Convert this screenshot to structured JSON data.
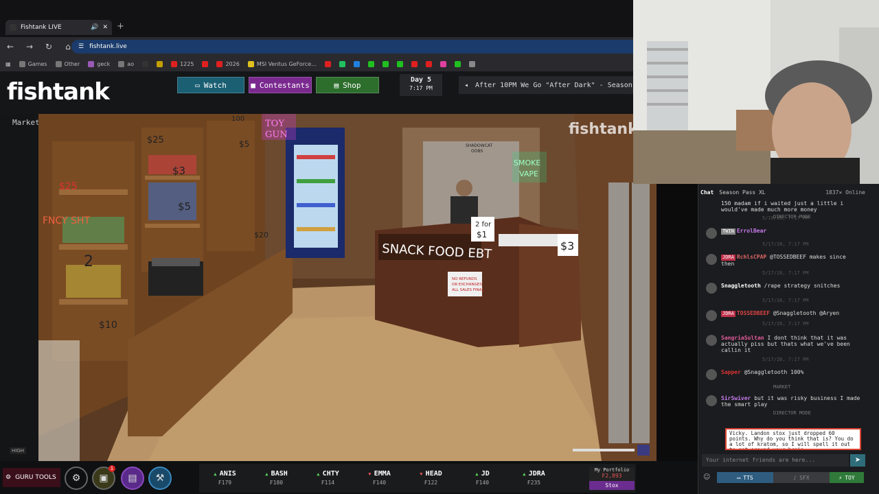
{
  "browser": {
    "tab_title": "Fishtank LIVE",
    "url": "fishtank.live",
    "bookmarks": [
      {
        "label": "Games",
        "color": "#777"
      },
      {
        "label": "Other",
        "color": "#777"
      },
      {
        "label": "geck",
        "color": "#9b59b6"
      },
      {
        "label": "ao",
        "color": "#777"
      },
      {
        "label": "",
        "color": "#333"
      },
      {
        "label": "",
        "color": "#c3a000"
      },
      {
        "label": "1225",
        "color": "#e02020"
      },
      {
        "label": "",
        "color": "#e02020"
      },
      {
        "label": "2026",
        "color": "#e02020"
      },
      {
        "label": "MSI Ventus GeForce...",
        "color": "#e0c020"
      },
      {
        "label": "",
        "color": "#e02020"
      },
      {
        "label": "",
        "color": "#20c060"
      },
      {
        "label": "",
        "color": "#2080e0"
      },
      {
        "label": "",
        "color": "#20c020"
      },
      {
        "label": "",
        "color": "#20c020"
      },
      {
        "label": "",
        "color": "#20c020"
      },
      {
        "label": "",
        "color": "#e02020"
      },
      {
        "label": "",
        "color": "#e02020"
      },
      {
        "label": "",
        "color": "#e040a0"
      },
      {
        "label": "",
        "color": "#20c020"
      },
      {
        "label": "",
        "color": "#888"
      }
    ]
  },
  "site": {
    "logo": "fishtank",
    "nav": {
      "watch": "Watch",
      "contestants": "Contestants",
      "shop": "Shop"
    },
    "day": {
      "label": "Day 5",
      "time": "7:17 PM"
    },
    "ticker": "After 10PM We Go \"After Dark\" - Season",
    "left_label": "Market",
    "quality": "HIGH",
    "watermark": "fishtank"
  },
  "bottom": {
    "guru_label": "GURU TOOLS",
    "guru_badge": "1",
    "stocks": [
      {
        "name": "ANIS",
        "price": "₣179",
        "dir": "up"
      },
      {
        "name": "BASH",
        "price": "₣180",
        "dir": "up"
      },
      {
        "name": "CHTY",
        "price": "₣114",
        "dir": "up"
      },
      {
        "name": "EMMA",
        "price": "₣140",
        "dir": "down"
      },
      {
        "name": "HEAD",
        "price": "₣122",
        "dir": "down"
      },
      {
        "name": "JD",
        "price": "₣140",
        "dir": "up"
      },
      {
        "name": "JDRA",
        "price": "₣235",
        "dir": "up"
      }
    ],
    "portfolio": {
      "label": "My Portfolio",
      "value": "₣2,893",
      "button": "Stox"
    }
  },
  "chat": {
    "tab": "Chat",
    "season_pass": "Season Pass XL",
    "online": "1837✕ Online",
    "messages": [
      {
        "badge": "",
        "user": "",
        "text": "150 madam if i waited just a little i would've made much more money",
        "user_color": "#ddd"
      },
      {
        "badge": "TWIN",
        "user": "ErrolBear",
        "text": "",
        "user_color": "#c97cf0"
      },
      {
        "badge": "JDRA",
        "user": "RchlsCPAP",
        "text": "@TOSSEDBEEF makes since then",
        "user_color": "#d66"
      },
      {
        "badge": "",
        "user": "Snaggletooth",
        "text": "/rape strategy snitches",
        "user_color": "#fff"
      },
      {
        "badge": "JDRA",
        "user": "TOSSEDBEEF",
        "text": "@Snaggletooth @Aryen",
        "user_color": "#d44"
      },
      {
        "badge": "",
        "user": "SangriaSultan",
        "text": "I dont think that it was actually piss but thats what we've been callin it",
        "user_color": "#e05a9a"
      },
      {
        "badge": "",
        "user": "Sapper",
        "text": "@Snaggletooth 100%",
        "user_color": "#d33"
      },
      {
        "badge": "",
        "user": "SirSwiver",
        "text": "but it was risky business I made the smart play",
        "user_color": "#c97cf0"
      }
    ],
    "system_labels": [
      "DIRECTOR MODE",
      "MARKET",
      "DIRECTOR MODE"
    ],
    "timestamps": [
      "5/10/26, 7:17 PM",
      "5/17/26, 7:17 PM",
      "5/17/26, 7:17 PM",
      "5/17/26, 7:17 PM",
      "5/17/26, 7:17 PM",
      "5/17/26, 7:17 PM"
    ],
    "popup": "Vicky. Landon stox just dropped 60 points. Why do you think that is? You do a lot of kratom, so I will spell it out to get around your brain",
    "input_placeholder": "Your internet friends are here...",
    "buttons": {
      "tts": "TTS",
      "sfx": "SFX",
      "toy": "TOY"
    }
  },
  "scene": {
    "signs": [
      "$25",
      "$3",
      "$5",
      "$20",
      "$2",
      "$10",
      "$3",
      "$25",
      "TOY GUN",
      "SMOKE VAPE",
      "SNACK FOOD EBT",
      "2 for $1",
      "NO REFUNDS OR EXCHANGES ALL SALES FINAL",
      "SHADOWCAT OOBS",
      "FNCY SHT",
      "100"
    ]
  }
}
